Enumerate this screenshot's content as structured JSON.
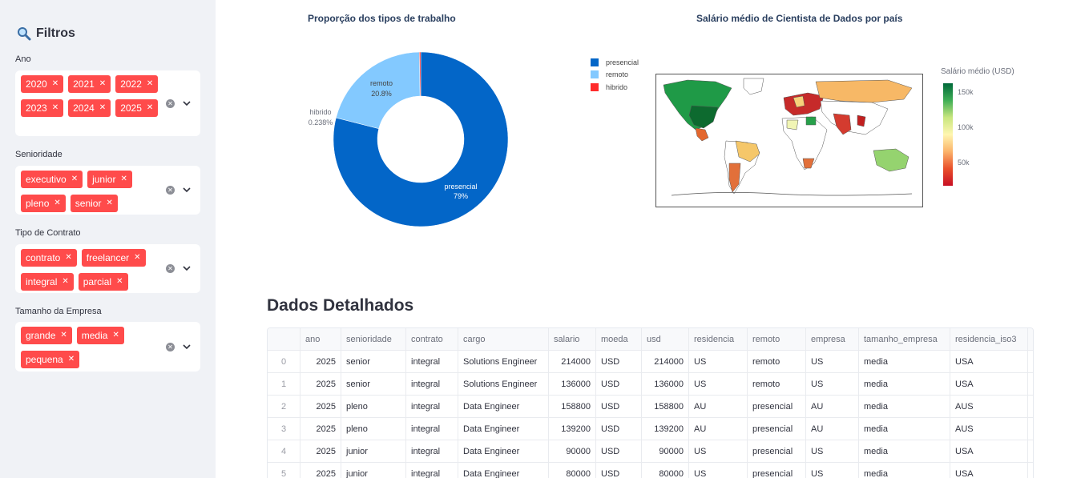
{
  "sidebar": {
    "title": "Filtros",
    "filters": [
      {
        "label": "Ano",
        "chips": [
          "2020",
          "2021",
          "2022",
          "2023",
          "2024",
          "2025"
        ]
      },
      {
        "label": "Senioridade",
        "chips": [
          "executivo",
          "junior",
          "pleno",
          "senior"
        ]
      },
      {
        "label": "Tipo de Contrato",
        "chips": [
          "contrato",
          "freelancer",
          "integral",
          "parcial"
        ]
      },
      {
        "label": "Tamanho da Empresa",
        "chips": [
          "grande",
          "media",
          "pequena"
        ]
      }
    ]
  },
  "donut": {
    "title": "Proporção dos tipos de trabalho",
    "chart_data": {
      "type": "pie",
      "title": "Proporção dos tipos de trabalho",
      "categories": [
        "presencial",
        "remoto",
        "hibrido"
      ],
      "values": [
        79,
        20.8,
        0.238
      ],
      "labels": [
        "79%",
        "20.8%",
        "0.238%"
      ],
      "colors": [
        "#0366c8",
        "#83c9ff",
        "#ff2b2b"
      ]
    }
  },
  "map": {
    "title": "Salário médio de Cientista de Dados por país",
    "colorbar_title": "Salário médio (USD)",
    "ticks": [
      "150k",
      "100k",
      "50k"
    ],
    "legend": [
      {
        "label": "presencial",
        "color": "#0366c8"
      },
      {
        "label": "remoto",
        "color": "#83c9ff"
      },
      {
        "label": "hibrido",
        "color": "#ff2b2b"
      }
    ]
  },
  "table": {
    "title": "Dados Detalhados",
    "columns": [
      "",
      "ano",
      "senioridade",
      "contrato",
      "cargo",
      "salario",
      "moeda",
      "usd",
      "residencia",
      "remoto",
      "empresa",
      "tamanho_empresa",
      "residencia_iso3"
    ],
    "rows": [
      [
        "0",
        "2025",
        "senior",
        "integral",
        "Solutions Engineer",
        "214000",
        "USD",
        "214000",
        "US",
        "remoto",
        "US",
        "media",
        "USA"
      ],
      [
        "1",
        "2025",
        "senior",
        "integral",
        "Solutions Engineer",
        "136000",
        "USD",
        "136000",
        "US",
        "remoto",
        "US",
        "media",
        "USA"
      ],
      [
        "2",
        "2025",
        "pleno",
        "integral",
        "Data Engineer",
        "158800",
        "USD",
        "158800",
        "AU",
        "presencial",
        "AU",
        "media",
        "AUS"
      ],
      [
        "3",
        "2025",
        "pleno",
        "integral",
        "Data Engineer",
        "139200",
        "USD",
        "139200",
        "AU",
        "presencial",
        "AU",
        "media",
        "AUS"
      ],
      [
        "4",
        "2025",
        "junior",
        "integral",
        "Data Engineer",
        "90000",
        "USD",
        "90000",
        "US",
        "presencial",
        "US",
        "media",
        "USA"
      ],
      [
        "5",
        "2025",
        "junior",
        "integral",
        "Data Engineer",
        "80000",
        "USD",
        "80000",
        "US",
        "presencial",
        "US",
        "media",
        "USA"
      ]
    ]
  }
}
